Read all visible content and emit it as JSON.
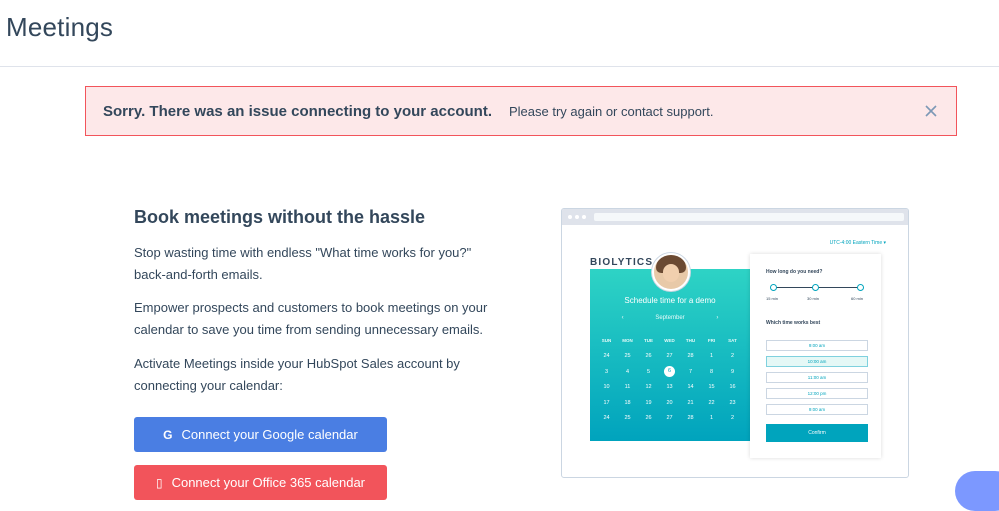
{
  "header": {
    "title": "Meetings"
  },
  "alert": {
    "title": "Sorry. There was an issue connecting to your account.",
    "message": "Please try again or contact support.",
    "close_icon": "close-icon"
  },
  "content": {
    "heading": "Book meetings without the hassle",
    "paragraphs": [
      "Stop wasting time with endless \"What time works for you?\" back-and-forth emails.",
      "Empower prospects and customers to book meetings on your calendar to save you time from sending unnecessary emails.",
      "Activate Meetings inside your HubSpot Sales account by connecting your calendar:"
    ],
    "buttons": {
      "google": {
        "icon": "G",
        "label": "Connect your Google calendar"
      },
      "office": {
        "icon": "▯",
        "label": "Connect your Office 365 calendar"
      }
    }
  },
  "illustration": {
    "timezone": "UTC-4:00 Eastern Time ▾",
    "logo": "BIOLYTICS",
    "calendar_title": "Schedule time for a demo",
    "month": "September",
    "prev": "‹",
    "next": "›",
    "weekdays": [
      "SUN",
      "MON",
      "TUE",
      "WED",
      "THU",
      "FRI",
      "SAT"
    ],
    "weeks": [
      [
        "24",
        "25",
        "26",
        "27",
        "28",
        "1",
        "2"
      ],
      [
        "3",
        "4",
        "5",
        "6",
        "7",
        "8",
        "9"
      ],
      [
        "10",
        "11",
        "12",
        "13",
        "14",
        "15",
        "16"
      ],
      [
        "17",
        "18",
        "19",
        "20",
        "21",
        "22",
        "23"
      ],
      [
        "24",
        "25",
        "26",
        "27",
        "28",
        "1",
        "2"
      ]
    ],
    "selected_day": "6",
    "duration_question": "How long do you need?",
    "durations": [
      "15 min",
      "30 min",
      "60 min"
    ],
    "time_question": "Which time works best",
    "times": [
      "9:00 am",
      "10:00 am",
      "11:00 am",
      "12:00 pm",
      "9:00 am"
    ],
    "active_time": "10:00 am",
    "confirm_label": "Confirm"
  },
  "colors": {
    "accent": "#00a4bd",
    "google_button": "#4a7ee3",
    "office_button": "#f2545b",
    "alert_bg": "#fde8e9",
    "alert_border": "#f2545b"
  }
}
